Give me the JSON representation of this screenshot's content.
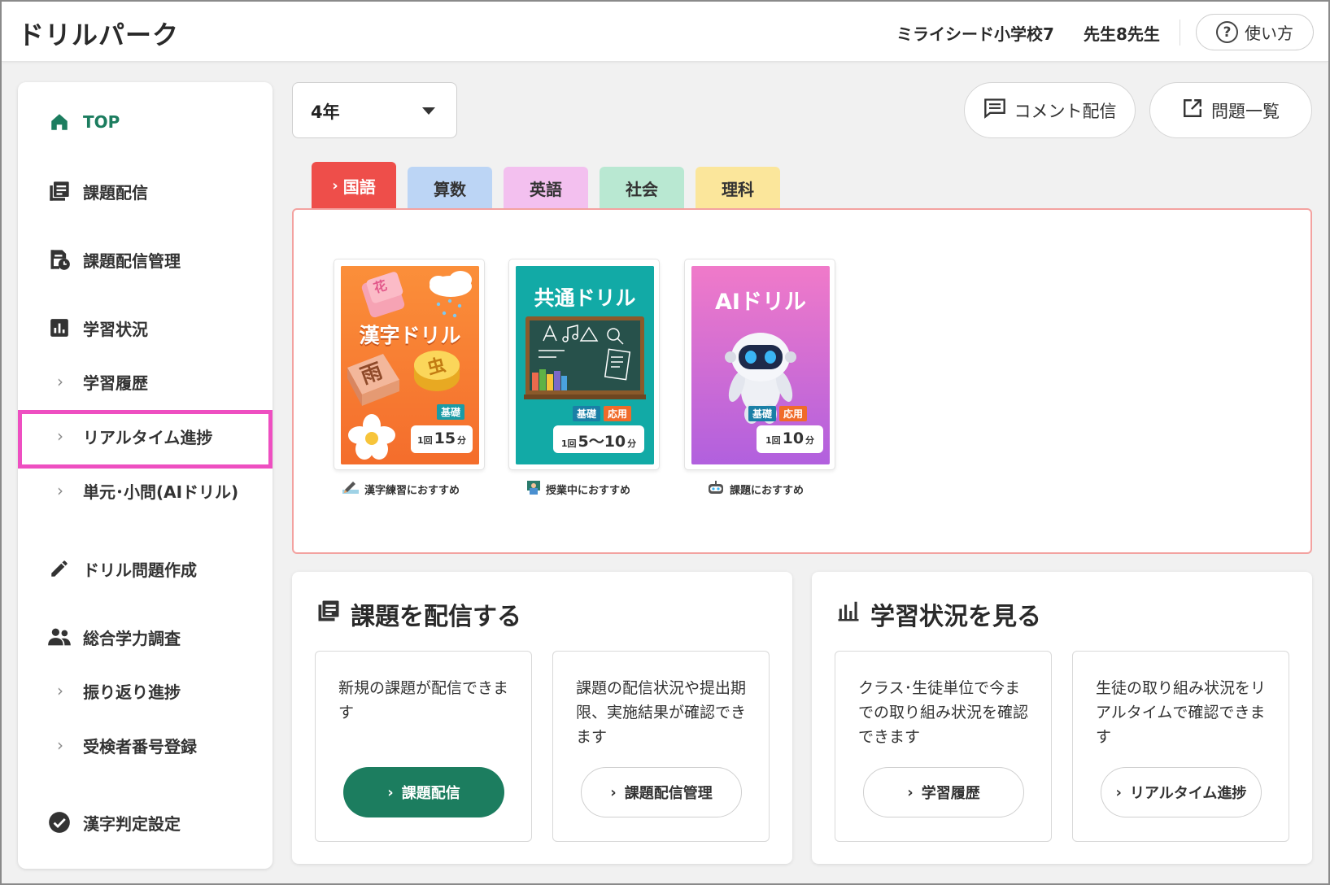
{
  "header": {
    "app_title": "ドリルパーク",
    "school": "ミライシード小学校7",
    "teacher": "先生8先生",
    "help_label": "使い方",
    "help_glyph": "?"
  },
  "sidebar": {
    "top": "TOP",
    "assign": "課題配信",
    "assign_manage": "課題配信管理",
    "study_status": "学習状況",
    "history": "学習履歴",
    "realtime": "リアルタイム進捗",
    "unit": "単元･小問(AIドリル)",
    "create": "ドリル問題作成",
    "survey": "総合学力調査",
    "review": "振り返り進捗",
    "register": "受検者番号登録",
    "kanji": "漢字判定設定"
  },
  "toolbar": {
    "grade": "4年",
    "comment": "コメント配信",
    "problems": "問題一覧"
  },
  "tabs": [
    {
      "label": "国語",
      "color": "#ee4e4a"
    },
    {
      "label": "算数",
      "color": "#bcd5f5"
    },
    {
      "label": "英語",
      "color": "#f3c0ef"
    },
    {
      "label": "社会",
      "color": "#b9e8d2"
    },
    {
      "label": "理科",
      "color": "#fbe69b"
    }
  ],
  "cards": [
    {
      "title": "漢字ドリル",
      "chars": [
        "花",
        "雨",
        "虫"
      ],
      "badges": [
        "基礎"
      ],
      "time_prefix": "1回",
      "time_value": "15",
      "time_unit": "分",
      "caption": "漢字練習におすすめ"
    },
    {
      "title": "共通ドリル",
      "badges": [
        "基礎",
        "応用"
      ],
      "time_prefix": "1回",
      "time_value": "5〜10",
      "time_unit": "分",
      "caption": "授業中におすすめ"
    },
    {
      "title": "AIドリル",
      "badges": [
        "基礎",
        "応用"
      ],
      "time_prefix": "1回",
      "time_value": "10",
      "time_unit": "分",
      "caption": "課題におすすめ"
    }
  ],
  "panels": {
    "assign": {
      "title": "課題を配信する",
      "box1": {
        "desc": "新規の課題が配信できます",
        "button": "課題配信"
      },
      "box2": {
        "desc": "課題の配信状況や提出期限、実施結果が確認できます",
        "button": "課題配信管理"
      }
    },
    "status": {
      "title": "学習状況を見る",
      "box1": {
        "desc": "クラス･生徒単位で今までの取り組み状況を確認できます",
        "button": "学習履歴"
      },
      "box2": {
        "desc": "生徒の取り組み状況をリアルタイムで確認できます",
        "button": "リアルタイム進捗"
      }
    }
  },
  "colors": {
    "brand_green": "#1c7d5f",
    "highlight_pink": "#ee4fc1",
    "active_tab_red": "#ee4e4a"
  }
}
